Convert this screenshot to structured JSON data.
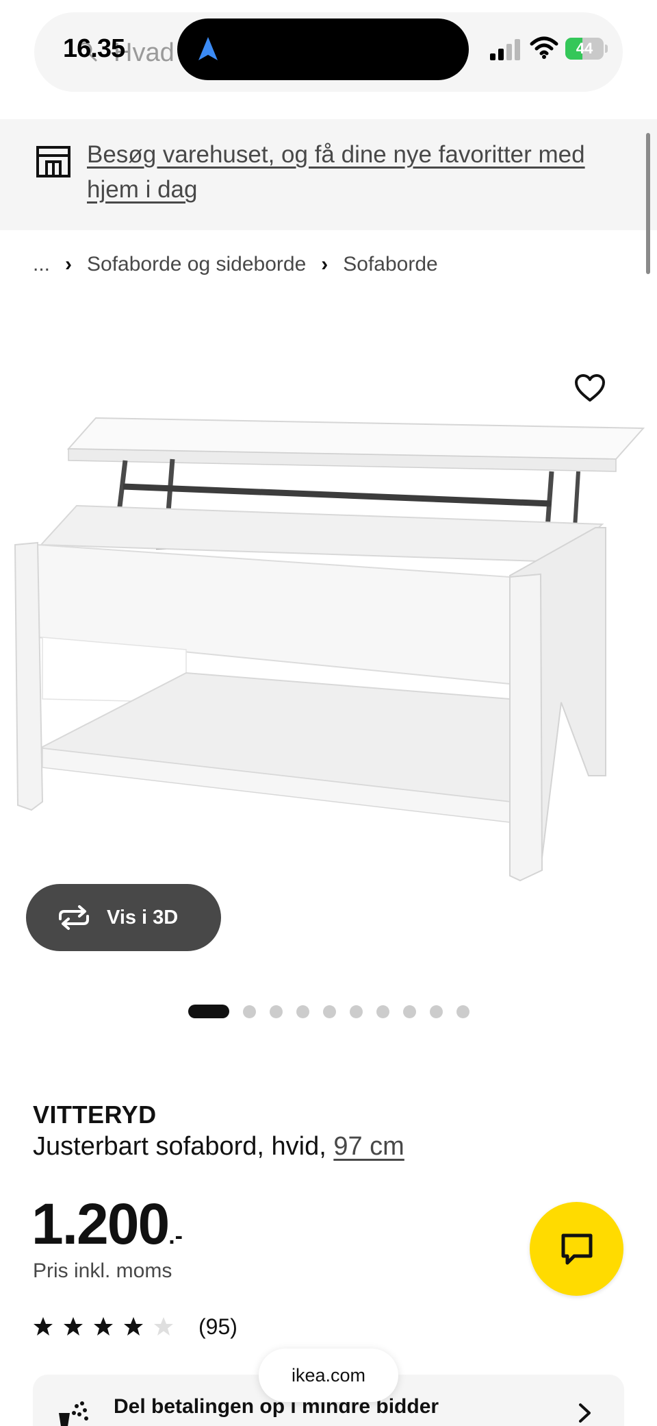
{
  "status_bar": {
    "time": "16.35",
    "battery": "44",
    "battery_level": 0.44
  },
  "search": {
    "placeholder_visible": "Hvad"
  },
  "banner": {
    "text": "Besøg varehuset, og få dine nye favoritter med hjem i dag"
  },
  "breadcrumb": {
    "ellipsis": "...",
    "items": [
      "Sofaborde og sideborde",
      "Sofaborde"
    ]
  },
  "product": {
    "view_3d_label": "Vis i 3D",
    "carousel": {
      "total": 10,
      "active_index": 0
    },
    "name": "VITTERYD",
    "description": "Justerbart sofabord, hvid, ",
    "size_link": "97 cm",
    "price": "1.200",
    "price_suffix": ".-",
    "vat_note": "Pris inkl. moms",
    "rating": {
      "value": 4,
      "max": 5,
      "count_label": "(95)"
    }
  },
  "payment": {
    "label": "Del betalingen op i mindre bidder"
  },
  "browser": {
    "url": "ikea.com"
  },
  "colors": {
    "accent_yellow": "#ffdb00",
    "dark_button": "#484848",
    "banner_bg": "#f5f5f5",
    "battery_green": "#34c759"
  },
  "icons": {
    "search": "search-icon",
    "navigation": "location-arrow-icon",
    "store": "store-icon",
    "favourite": "heart-icon",
    "view3d": "rotate-3d-icon",
    "chat": "chat-bubble-icon",
    "payment": "payment-split-icon",
    "chevron": "chevron-right-icon"
  }
}
